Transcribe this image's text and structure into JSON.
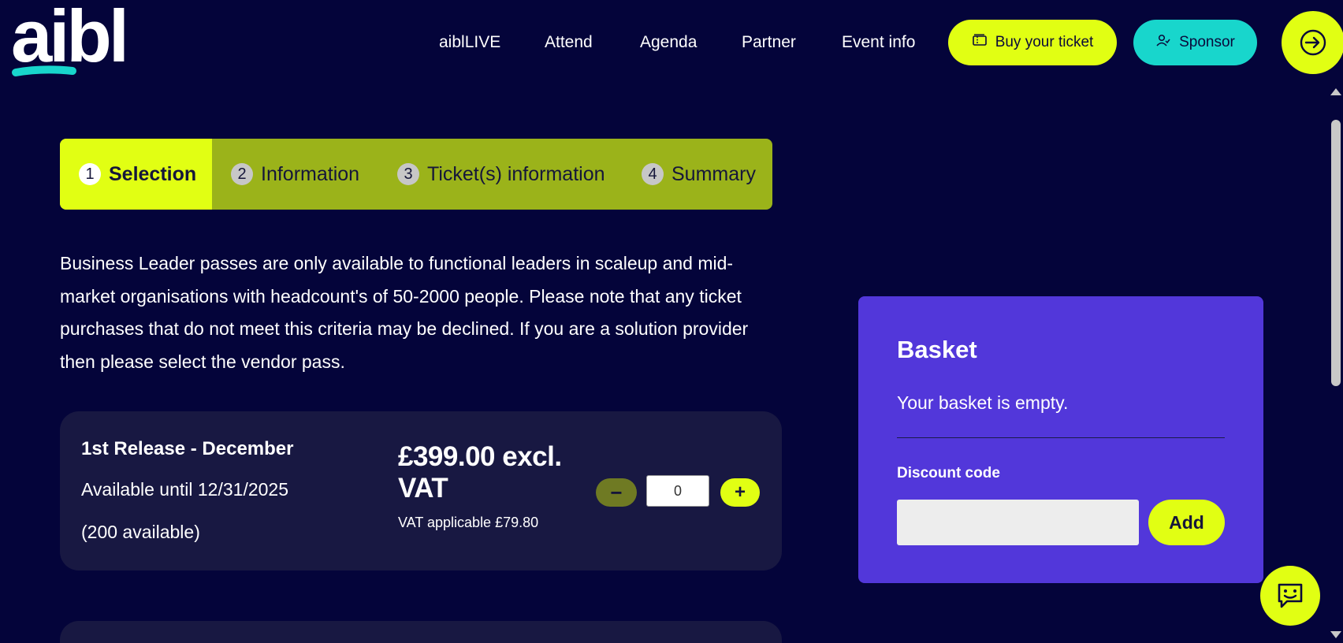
{
  "header": {
    "logo_text": "aibl",
    "nav": [
      {
        "label": "aiblLIVE"
      },
      {
        "label": "Attend"
      },
      {
        "label": "Agenda"
      },
      {
        "label": "Partner"
      },
      {
        "label": "Event info"
      }
    ],
    "buy_ticket_label": "Buy your ticket",
    "sponsor_label": "Sponsor",
    "icons": {
      "ticket": "ticket-icon",
      "sponsor": "people-icon",
      "login": "login-arrow-icon"
    }
  },
  "stepper": {
    "steps": [
      {
        "num": "1",
        "label": "Selection",
        "active": true
      },
      {
        "num": "2",
        "label": "Information",
        "active": false
      },
      {
        "num": "3",
        "label": "Ticket(s) information",
        "active": false
      },
      {
        "num": "4",
        "label": "Summary",
        "active": false
      }
    ]
  },
  "intro": {
    "text": "Business Leader passes are only available to functional leaders in scaleup and mid-market organisations with headcount's of 50-2000 people. Please note that any ticket purchases that do not meet this criteria may be declined. If you are a solution provider then please select the vendor pass."
  },
  "tickets": [
    {
      "name": "1st Release - December",
      "availability": "Available until 12/31/2025",
      "count": "(200 available)",
      "price": "£399.00 excl. VAT",
      "vat": "VAT applicable £79.80",
      "quantity": "0",
      "minus_label": "−",
      "plus_label": "+"
    }
  ],
  "basket": {
    "title": "Basket",
    "empty_text": "Your basket is empty.",
    "discount_label": "Discount code",
    "discount_value": "",
    "add_label": "Add"
  },
  "colors": {
    "background": "#04043a",
    "accent_yellow": "#e1ff13",
    "accent_teal": "#18d6cc",
    "basket_purple": "#5237da",
    "card": "#181842"
  },
  "chat": {
    "icon": "chat-smile-icon"
  }
}
